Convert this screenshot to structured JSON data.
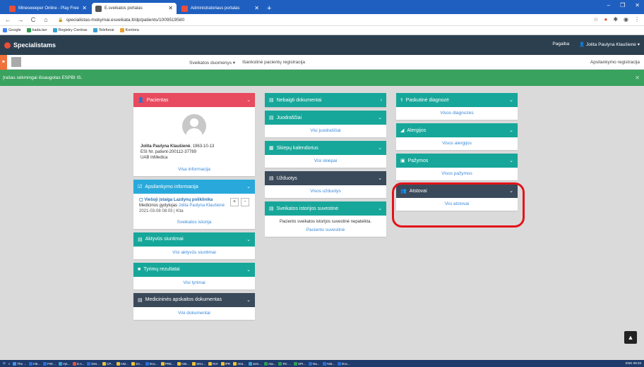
{
  "browser": {
    "tabs": [
      {
        "title": "Minesweeper Online - Play Free",
        "color": "#e94f3a",
        "active": false
      },
      {
        "title": "E.sveikatos portalas",
        "color": "#555555",
        "active": true
      },
      {
        "title": "Administratoriaus portalas",
        "color": "#e94f3a",
        "active": false
      }
    ],
    "url": "specialistas-mokymai.esveikata.lt/dp/patients/1009519580",
    "bookmarks": [
      {
        "label": "Google",
        "color": "#4285f4"
      },
      {
        "label": "kada.lan",
        "color": "#2e9e4f"
      },
      {
        "label": "Registry Centras",
        "color": "#3aa0d0"
      },
      {
        "label": "Telefonai",
        "color": "#3aa0d0"
      },
      {
        "label": "Kontora",
        "color": "#f0a030"
      }
    ]
  },
  "app": {
    "brand": "Specialistams",
    "help": "Pagalba",
    "user": "Jolita Paulyna Klaušienė"
  },
  "patientbar": {
    "menu1": "Sveikatos duomenys",
    "menu2": "Išankstinė pacientų registracija",
    "right": "Apsilankymo registracija"
  },
  "alert": {
    "text": "Įrašas sėkmingai išsaugotas ESPBI IS."
  },
  "col1": {
    "patient": {
      "title": "Pacientas",
      "name": "Jolita Paulyna Klaušienė",
      "dob": ", 1963-10-13",
      "esi": "ESI Nr. patient-200112-37789",
      "org": "UAB InMedica",
      "link": "Visa informacija"
    },
    "visit": {
      "title": "Apsilankymo informacija",
      "institution": "Viešoji įstaiga Lazdynų poliklinika",
      "doctor_prefix": "Medicinos gydytojas",
      "doctor": "Jolita Paulyna Klaušienė",
      "meta": "2021-03-08 08:03 | Kita",
      "plus": "+",
      "minus": "-",
      "link": "Sveikatos istorija"
    },
    "referrals": {
      "title": "Aktyvūs siuntimai",
      "link": "Visi aktyvūs siuntimai"
    },
    "tests": {
      "title": "Tyrimų rezultatai",
      "link": "Visi tyrimai"
    },
    "documents": {
      "title": "Medicininės apskaitos dokumentas",
      "link": "Visi dokumentai"
    }
  },
  "col2": {
    "unfinished": {
      "title": "Nebaigti dokumentai"
    },
    "drafts": {
      "title": "Juodraščiai",
      "link": "Visi juodraščiai"
    },
    "vaccines": {
      "title": "Skiepų kalendorius",
      "link": "Visi skiepai"
    },
    "tasks": {
      "title": "Užduotys",
      "link": "Visos užduotys"
    },
    "summary": {
      "title": "Sveikatos istorijos suvestinė",
      "text": "Paciento sveikatos istorijos suvestinė nepateikta.",
      "link": "Paciento suvestinė"
    }
  },
  "col3": {
    "diagnosis": {
      "title": "Paskutinė diagnozė",
      "link": "Visos diagnozės"
    },
    "allergies": {
      "title": "Alergijos",
      "link": "Visos alergijos"
    },
    "certificates": {
      "title": "Pažymos",
      "link": "Visos pažymos"
    },
    "representatives": {
      "title": "Atstovai",
      "link": "Visi atstovai"
    }
  },
  "taskbar": {
    "items": [
      "The ...",
      "Inb...",
      "FW:...",
      "Vyt...",
      "E.s...",
      "Des...",
      "CP...",
      "Atst...",
      "SA...",
      "Doc...",
      "PRE...",
      "Atst...",
      "SKU...",
      "NVI",
      "IPR",
      "Atst...",
      "Jom...",
      "Ata...",
      "RC ...",
      "SPI...",
      "Na...",
      "Atst...",
      "Doc..."
    ],
    "clock": "ENG 08:33"
  }
}
